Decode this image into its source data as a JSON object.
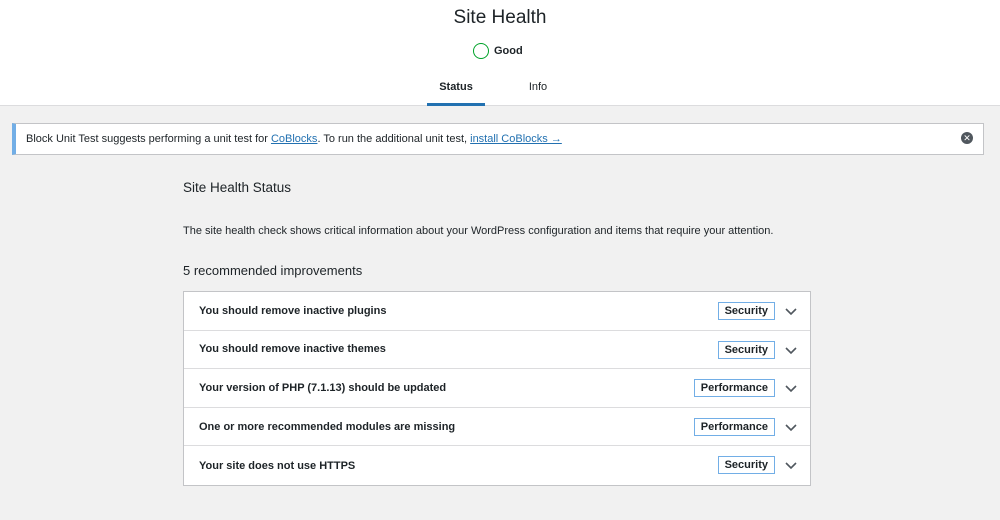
{
  "header": {
    "title": "Site Health",
    "rating": "Good",
    "rating_color": "#00a32a",
    "tabs": [
      {
        "label": "Status",
        "active": true
      },
      {
        "label": "Info",
        "active": false
      }
    ]
  },
  "notice": {
    "text_before": "Block Unit Test suggests performing a unit test for ",
    "link1": "CoBlocks",
    "text_middle": ". To run the additional unit test, ",
    "link2": "install CoBlocks →",
    "dismiss_icon": "dismiss-icon"
  },
  "main": {
    "title": "Site Health Status",
    "description": "The site health check shows critical information about your WordPress configuration and items that require your attention.",
    "improvements_heading": "5 recommended improvements",
    "issues": [
      {
        "label": "You should remove inactive plugins",
        "badge": "Security"
      },
      {
        "label": "You should remove inactive themes",
        "badge": "Security"
      },
      {
        "label": "Your version of PHP (7.1.13) should be updated",
        "badge": "Performance"
      },
      {
        "label": "One or more recommended modules are missing",
        "badge": "Performance"
      },
      {
        "label": "Your site does not use HTTPS",
        "badge": "Security"
      }
    ]
  },
  "colors": {
    "accent": "#2271b1",
    "notice_border": "#72aee6",
    "good": "#00a32a"
  }
}
